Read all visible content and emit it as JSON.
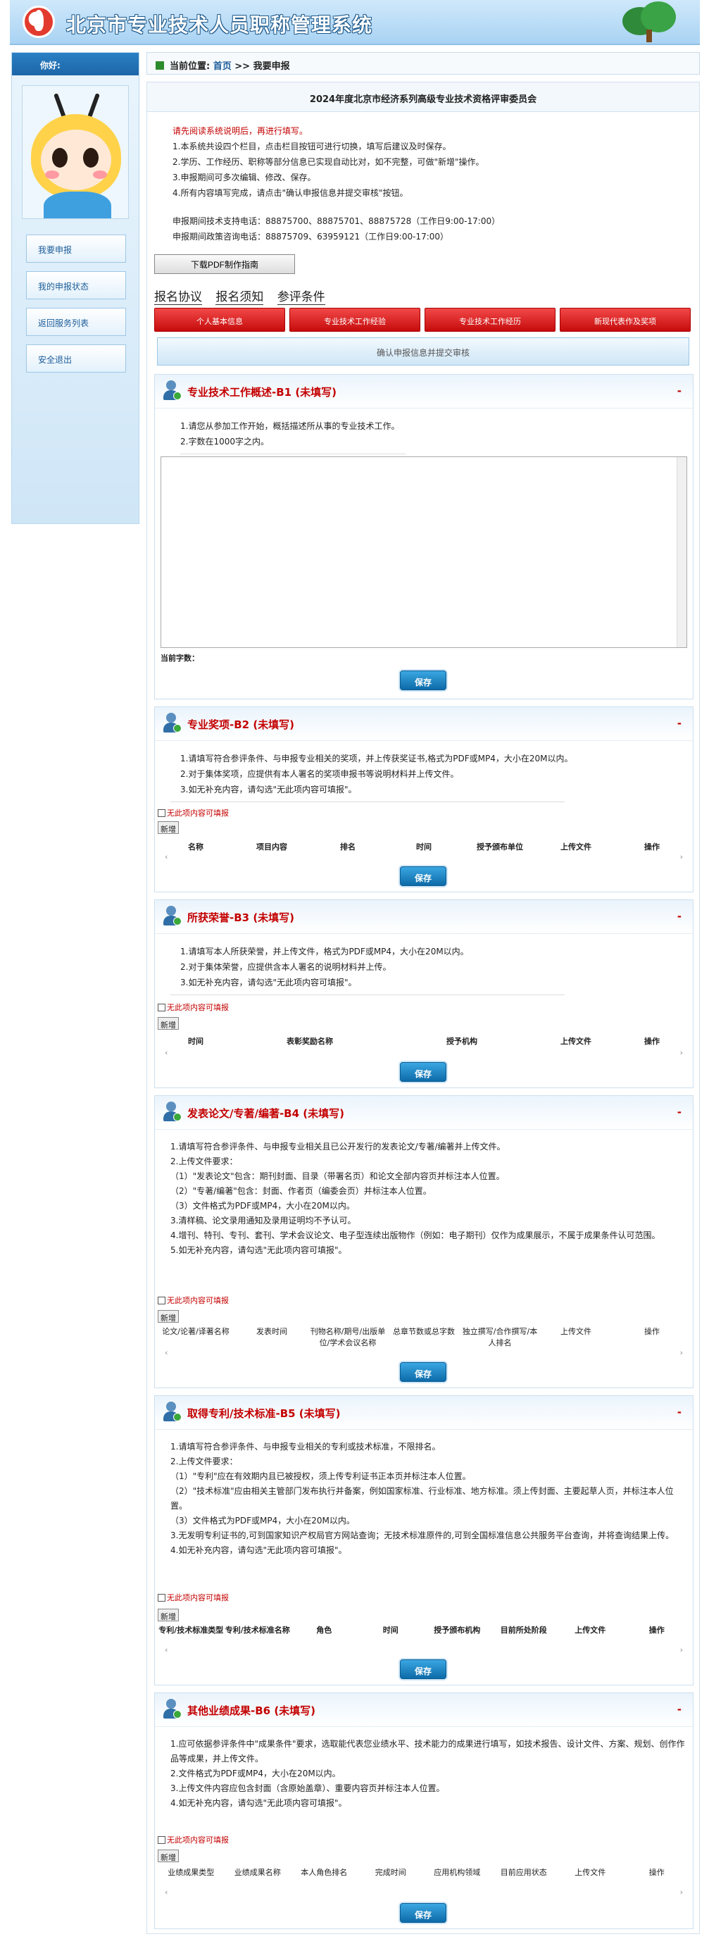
{
  "app": {
    "title": "北京市专业技术人员职称管理系统"
  },
  "sidebar": {
    "greeting": "你好:",
    "menu": [
      {
        "label": "我要申报"
      },
      {
        "label": "我的申报状态"
      },
      {
        "label": "返回服务列表"
      },
      {
        "label": "安全退出"
      }
    ]
  },
  "breadcrumb": {
    "prefix": "当前位置:",
    "home": "首页",
    "sep": ">>",
    "current": "我要申报"
  },
  "main": {
    "title": "2024年度北京市经济系列高级专业技术资格评审委员会",
    "warning": "请先阅读系统说明后，再进行填写。",
    "notes": [
      "1.本系统共设四个栏目，点击栏目按钮可进行切换，填写后建议及时保存。",
      "2.学历、工作经历、职称等部分信息已实现自动比对，如不完整，可做\"新增\"操作。",
      "3.申报期间可多次编辑、修改、保存。",
      "4.所有内容填写完成，请点击\"确认申报信息并提交审核\"按钮。"
    ],
    "contacts": [
      "申报期间技术支持电话：88875700、88875701、88875728（工作日9:00-17:00）",
      "申报期间政策咨询电话：88875709、63959121（工作日9:00-17:00）"
    ],
    "pdf_button": "下载PDF制作指南",
    "tabs": [
      "报名协议",
      "报名须知",
      "参评条件"
    ],
    "steps": [
      "个人基本信息",
      "专业技术工作经验",
      "专业技术工作经历",
      "新现代表作及奖项"
    ],
    "confirm_button": "确认申报信息并提交审核"
  },
  "common": {
    "collapse": "-",
    "save": "保存",
    "add": "新增",
    "no_content": "无此项内容可填报"
  },
  "b1": {
    "title": "专业技术工作概述-B1 (未填写)",
    "notes": [
      "1.请您从参加工作开始，概括描述所从事的专业技术工作。",
      "2.字数在1000字之内。"
    ],
    "count_label": "当前字数："
  },
  "b2": {
    "title": "专业奖项-B2 (未填写)",
    "notes": [
      "1.请填写符合参评条件、与申报专业相关的奖项，并上传获奖证书,格式为PDF或MP4，大小在20M以内。",
      "2.对于集体奖项，应提供有本人署名的奖项申报书等说明材料并上传文件。",
      "3.如无补充内容，请勾选\"无此项内容可填报\"。"
    ],
    "columns": [
      "名称",
      "项目内容",
      "排名",
      "时间",
      "授予颁布单位",
      "上传文件",
      "操作"
    ]
  },
  "b3": {
    "title": "所获荣誉-B3 (未填写)",
    "notes": [
      "1.请填写本人所获荣誉，并上传文件，格式为PDF或MP4，大小在20M以内。",
      "2.对于集体荣誉，应提供含本人署名的说明材料并上传。",
      "3.如无补充内容，请勾选\"无此项内容可填报\"。"
    ],
    "columns": [
      "时间",
      "表彰奖励名称",
      "授予机构",
      "上传文件",
      "操作"
    ]
  },
  "b4": {
    "title": "发表论文/专著/编著-B4 (未填写)",
    "notes": [
      "1.请填写符合参评条件、与申报专业相关且已公开发行的发表论文/专著/编著并上传文件。",
      "2.上传文件要求：",
      "（1）\"发表论文\"包含：期刊封面、目录（带署名页）和论文全部内容页并标注本人位置。",
      "（2）\"专著/编著\"包含：封面、作者页（编委会页）并标注本人位置。",
      "（3）文件格式为PDF或MP4，大小在20M以内。",
      "3.清样稿、论文录用通知及录用证明均不予认可。",
      "4.增刊、特刊、专刊、套刊、学术会议论文、电子型连续出版物作（例如：电子期刊）仅作为成果展示，不属于成果条件认可范围。",
      "5.如无补充内容，请勾选\"无此项内容可填报\"。"
    ],
    "columns": [
      "论文/论著/译著名称",
      "发表时间",
      "刊物名称/期号/出版单位/学术会议名称",
      "总章节数或总字数",
      "独立撰写/合作撰写/本人排名",
      "上传文件",
      "操作"
    ]
  },
  "b5": {
    "title": "取得专利/技术标准-B5 (未填写)",
    "notes": [
      "1.请填写符合参评条件、与申报专业相关的专利或技术标准，不限排名。",
      "2.上传文件要求：",
      "（1）\"专利\"应在有效期内且已被授权，须上传专利证书正本页并标注本人位置。",
      "（2）\"技术标准\"应由相关主管部门发布执行并备案，例如国家标准、行业标准、地方标准。须上传封面、主要起草人页，并标注本人位置。",
      "（3）文件格式为PDF或MP4，大小在20M以内。",
      "3.无发明专利证书的,可到国家知识产权局官方网站查询；无技术标准原件的,可到全国标准信息公共服务平台查询，并将查询结果上传。",
      "4.如无补充内容，请勾选\"无此项内容可填报\"。"
    ],
    "columns": [
      "专利/技术标准类型",
      "专利/技术标准名称",
      "角色",
      "时间",
      "授予颁布机构",
      "目前所处阶段",
      "上传文件",
      "操作"
    ]
  },
  "b6": {
    "title": "其他业绩成果-B6 (未填写)",
    "notes": [
      "1.应可依据参评条件中\"成果条件\"要求，选取能代表您业绩水平、技术能力的成果进行填写，如技术报告、设计文件、方案、规划、创作作品等成果，并上传文件。",
      "2.文件格式为PDF或MP4，大小在20M以内。",
      "3.上传文件内容应包含封面（含原始盖章）、重要内容页并标注本人位置。",
      "4.如无补充内容，请勾选\"无此项内容可填报\"。"
    ],
    "columns": [
      "业绩成果类型",
      "业绩成果名称",
      "本人角色排名",
      "完成时间",
      "应用机构领域",
      "目前应用状态",
      "上传文件",
      "操作"
    ]
  },
  "colors": {
    "accent": "#c40000",
    "brand": "#1d66a8",
    "save": "#0d6aa8"
  }
}
